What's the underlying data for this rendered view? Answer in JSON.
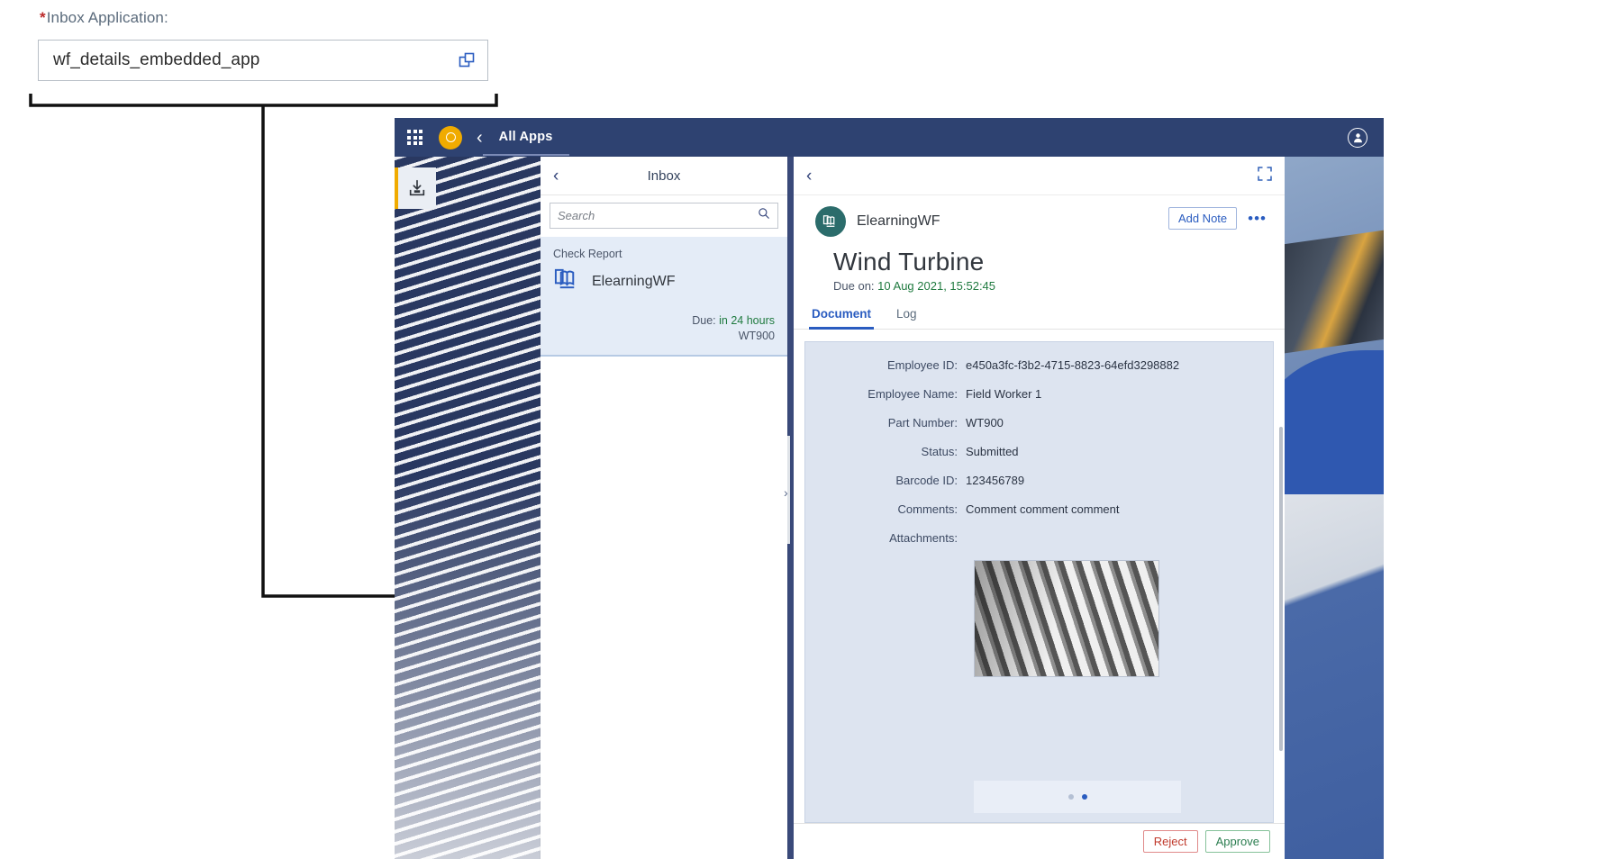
{
  "config_form": {
    "label": "Inbox Application:",
    "required_marker": "*",
    "value": "wf_details_embedded_app",
    "value_help_icon": "value-help-icon"
  },
  "shellbar": {
    "grid_icon": "app-grid-icon",
    "logo_icon": "company-logo-icon",
    "back_icon": "back-chevron-icon",
    "title": "All Apps",
    "user_icon": "user-account-icon"
  },
  "rail": {
    "tile_icon": "inbox-tray-icon"
  },
  "inbox": {
    "back_icon": "back-chevron-icon",
    "title": "Inbox",
    "search": {
      "placeholder": "Search",
      "icon": "search-icon"
    },
    "items": [
      {
        "category": "Check Report",
        "icon": "elearning-book-icon",
        "name": "ElearningWF",
        "due_label": "Due:",
        "due_value": "in 24 hours",
        "reference": "WT900"
      }
    ]
  },
  "splitter": {
    "arrow_icon": "chevron-right-icon"
  },
  "detail": {
    "back_icon": "back-chevron-icon",
    "expand_icon": "full-screen-icon",
    "avatar_icon": "elearning-book-icon",
    "workflow_name": "ElearningWF",
    "add_note_label": "Add Note",
    "more_icon": "overflow-menu-icon",
    "title": "Wind Turbine",
    "due_label": "Due on:",
    "due_value": "10 Aug 2021, 15:52:45",
    "tabs": [
      {
        "label": "Document",
        "active": true
      },
      {
        "label": "Log",
        "active": false
      }
    ],
    "fields": [
      {
        "label": "Employee ID:",
        "value": "e450a3fc-f3b2-4715-8823-64efd3298882"
      },
      {
        "label": "Employee Name:",
        "value": "Field Worker 1"
      },
      {
        "label": "Part Number:",
        "value": "WT900"
      },
      {
        "label": "Status:",
        "value": "Submitted"
      },
      {
        "label": "Barcode ID:",
        "value": "123456789"
      },
      {
        "label": "Comments:",
        "value": "Comment comment comment"
      },
      {
        "label": "Attachments:",
        "value": ""
      }
    ],
    "attachment_image_alt": "turbine-blades-photo",
    "carousel": {
      "dots": 2,
      "active_index": 1
    },
    "footer": {
      "reject_label": "Reject",
      "approve_label": "Approve"
    }
  },
  "colors": {
    "shellbar": "#2e4271",
    "accent_blue": "#2a5cc0",
    "due_green": "#1f7a3f",
    "reject_red": "#c0392b",
    "approve_green": "#2a7d4f",
    "logo_orange": "#f0ab00",
    "avatar_teal": "#2b6c6b"
  }
}
